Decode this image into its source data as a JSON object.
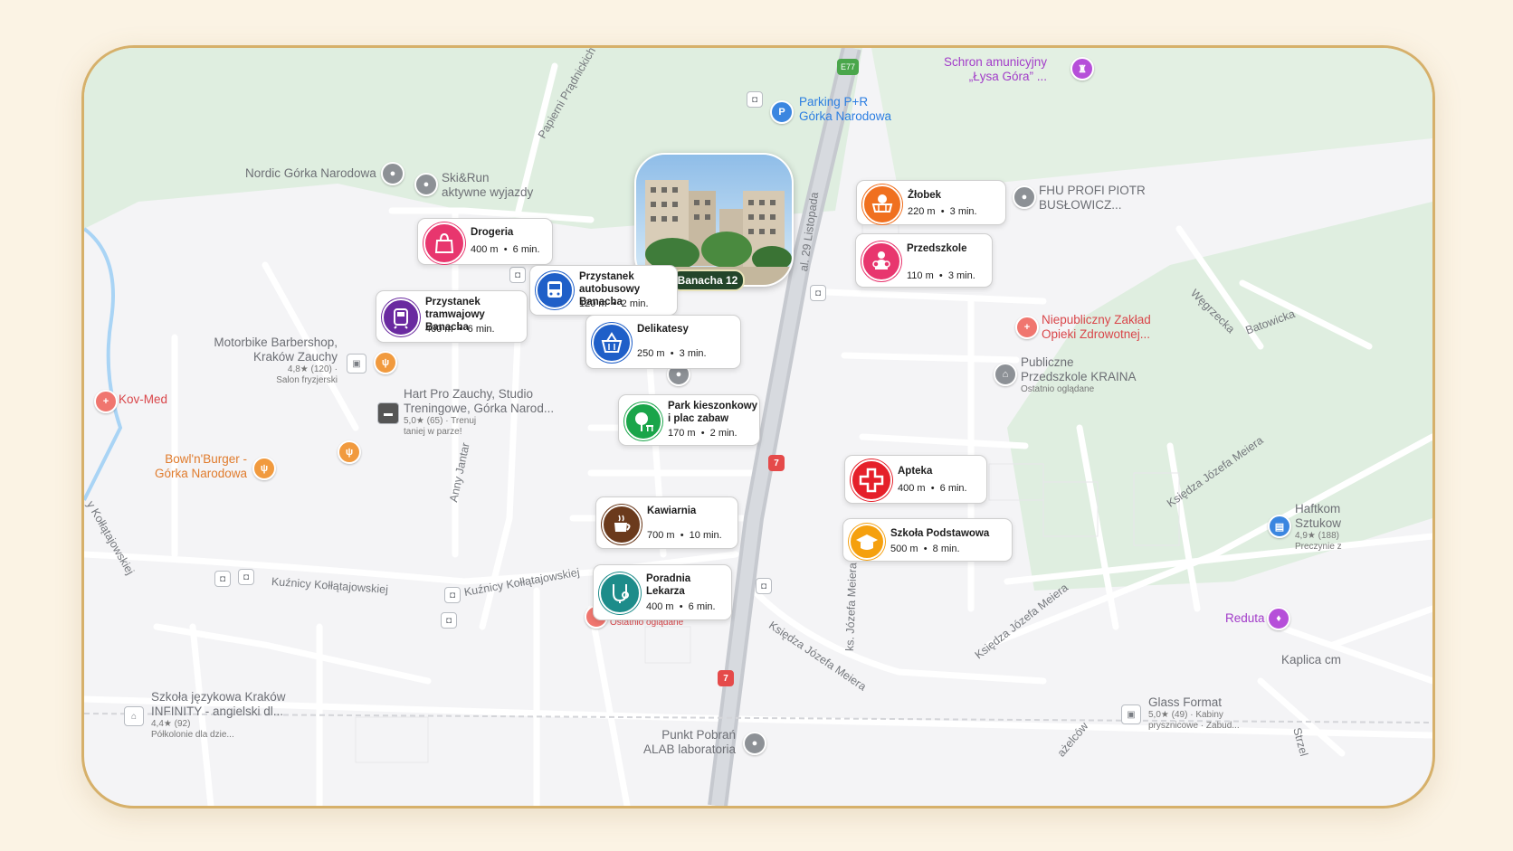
{
  "streets": {
    "papierni": "Papierni Prądnickich",
    "al29": "al. 29 Listopada",
    "wegrzecka": "Węgrzecka",
    "batowicka": "Batowicka",
    "meiera1": "Księdza Józefa Meiera",
    "meiera2": "Księdza Józefa Meiera",
    "meiera3": "Księdza Józefa Meiera",
    "meiera_ks": "ks. Józefa Meiera",
    "kollatajowskiej1": "Kuźnicy Kołłątajowskiej",
    "kollatajowskiej2": "Kuźnicy Kołłątajowskiej",
    "kollatajowskiej3": "y Kołłątajowskiej",
    "anny_jantar": "Anny Jantar",
    "strzel": "Strzel",
    "wiczelcow": "ażelców",
    "e77": "E77",
    "r7a": "7",
    "r7b": "7"
  },
  "places": {
    "schron": "Schron amunicyjny",
    "schron2": "„Łysa Góra” ...",
    "parking": "Parking P+R",
    "parking2": "Górka Narodowa",
    "nordic": "Nordic Górka Narodowa",
    "skirun": "Ski&Run",
    "skirun2": "aktywne wyjazdy",
    "fhu": "FHU PROFI PIOTR",
    "fhu2": "BUSŁOWICZ...",
    "niepubliczny": "Niepubliczny Zakład",
    "niepubliczny2": "Opieki Zdrowotnej...",
    "przedszkole_krain": "Publiczne",
    "przedszkole_krain2": "Przedszkole KRAINA",
    "przedszkole_krain3": "Ostatnio oglądane",
    "motorbike": "Motorbike Barbershop,",
    "motorbike2": "Kraków Zauchy",
    "motorbike3": "4,8★ (120) ·",
    "motorbike4": "Salon fryzjerski",
    "kovmed": "Kov-Med",
    "hart": "Hart Pro Zauchy, Studio",
    "hart2": "Treningowe, Górka Narod...",
    "hart3": "5,0★ (65) · Trenuj",
    "hart4": "taniej w parze!",
    "bowl": "Bowl'n'Burger -",
    "bowl2": "Górka Narodowa",
    "haftkom": "Haftkom",
    "haftkom2": "Sztukow",
    "haftkom3": "4,9★ (188)",
    "haftkom4": "Preczynie z",
    "reduta": "Reduta",
    "kaplica": "Kaplica cm",
    "ostatnio": "Ostatnio oglądane",
    "infinity": "Szkoła językowa Kraków",
    "infinity2": "INFINITY - angielski dl...",
    "infinity3": "4,4★ (92)",
    "infinity4": "Półkolonie dla dzie...",
    "glass": "Glass Format",
    "glass2": "5,0★ (49) · Kabiny",
    "glass3": "prysznicowe · Zabud...",
    "punkt": "Punkt Pobrań",
    "punkt2": "ALAB laboratoria",
    "delik_partial": "a"
  },
  "property": {
    "label": "Banacha 12"
  },
  "pois": [
    {
      "id": "drogeria",
      "title": "Drogeria",
      "dist": "400 m",
      "time": "6 min.",
      "color": "#e8366e",
      "icon": "shopping-bag-icon"
    },
    {
      "id": "przystanek-bus",
      "title": "Przystanek autobusowy Banacha",
      "dist": "120 m",
      "time": "2 min.",
      "color": "#1f5fc8",
      "icon": "bus-icon"
    },
    {
      "id": "przystanek-tram",
      "title": "Przystanek tramwajowy Banacha",
      "dist": "400 m",
      "time": "6 min.",
      "color": "#6a2aa0",
      "icon": "tram-icon"
    },
    {
      "id": "delikatesy",
      "title": "Delikatesy",
      "dist": "250 m",
      "time": "3 min.",
      "color": "#1f5fc8",
      "icon": "basket-icon"
    },
    {
      "id": "park",
      "title": "Park kieszonkowy i plac zabaw",
      "dist": "170 m",
      "time": "2 min.",
      "color": "#1aa54a",
      "icon": "tree-icon"
    },
    {
      "id": "kawiarnia",
      "title": "Kawiarnia",
      "dist": "700 m",
      "time": "10 min.",
      "color": "#6b3a1c",
      "icon": "coffee-icon"
    },
    {
      "id": "poradnia",
      "title": "Poradnia Lekarza",
      "dist": "400 m",
      "time": "6 min.",
      "color": "#1d8c8a",
      "icon": "stethoscope-icon"
    },
    {
      "id": "zlobek",
      "title": "Żłobek",
      "dist": "220 m",
      "time": "3 min.",
      "color": "#f07020",
      "icon": "cradle-icon"
    },
    {
      "id": "przedszkole",
      "title": "Przedszkole",
      "dist": "110 m",
      "time": "3 min.",
      "color": "#e8366e",
      "icon": "children-icon"
    },
    {
      "id": "apteka",
      "title": "Apteka",
      "dist": "400 m",
      "time": "6 min.",
      "color": "#e5202a",
      "icon": "medical-cross-icon"
    },
    {
      "id": "szkola",
      "title": "Szkoła Podstawowa",
      "dist": "500 m",
      "time": "8 min.",
      "color": "#f5a00e",
      "icon": "graduation-cap-icon"
    }
  ]
}
